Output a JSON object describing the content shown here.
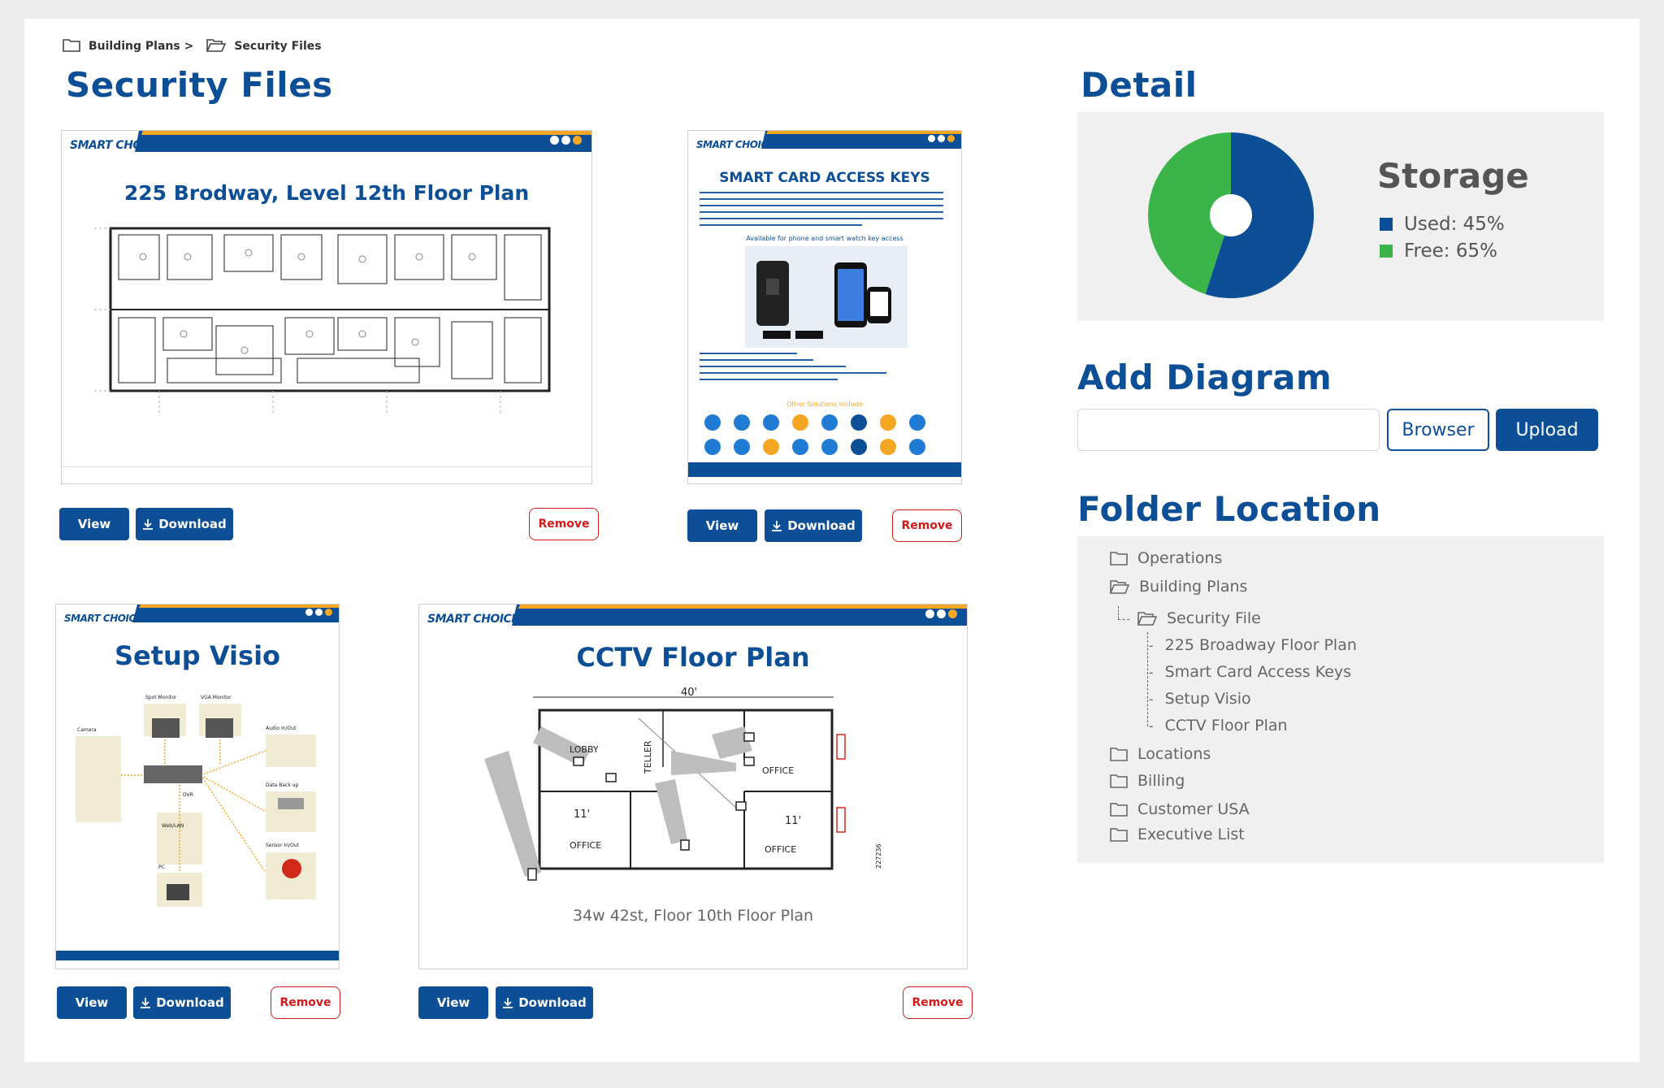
{
  "breadcrumb": {
    "parent": "Building Plans >",
    "current": "Security Files",
    "parent_icon": "folder-icon",
    "current_icon": "folder-open-icon"
  },
  "page_title": "Security Files",
  "colors": {
    "brand_blue": "#0d4f97",
    "accent_orange": "#f5a623",
    "remove_red": "#d11a1a",
    "chart_used": "#0d4f97",
    "chart_free": "#3bb54a"
  },
  "files": [
    {
      "logo": "SMART CHOICE",
      "title": "225 Brodway, Level 12th Floor Plan",
      "thumbnail": "floor-plan-drawing",
      "actions": {
        "view": "View",
        "download": "Download",
        "remove": "Remove"
      }
    },
    {
      "logo": "SMART CHOICE",
      "title": "SMART CARD ACCESS KEYS",
      "subtitle": "Available for phone and smart watch key access",
      "other": "Other Solutions Include",
      "thumbnail": "access-keys-brochure",
      "actions": {
        "view": "View",
        "download": "Download",
        "remove": "Remove"
      }
    },
    {
      "logo": "SMART CHOICE",
      "title": "Setup Visio",
      "thumbnail": "visio-diagram",
      "labels": [
        "Spot Monitor",
        "VGA Monitor",
        "Audio In/Out",
        "Camera",
        "DVR",
        "Data Back up",
        "Web/LAN",
        "Sensor In/Out",
        "PC"
      ],
      "actions": {
        "view": "View",
        "download": "Download",
        "remove": "Remove"
      }
    },
    {
      "logo": "SMART CHOICE",
      "title": "CCTV Floor Plan",
      "caption": "34w 42st, Floor 10th Floor Plan",
      "thumbnail": "cctv-plan",
      "labels": [
        "40'",
        "LOBBY",
        "TELLER",
        "OFFICE",
        "11'",
        "OFFICE",
        "11'",
        "OFFICE",
        "227236"
      ],
      "actions": {
        "view": "View",
        "download": "Download",
        "remove": "Remove"
      }
    }
  ],
  "detail": {
    "title": "Detail",
    "storage_label": "Storage",
    "used_label": "Used: 45%",
    "free_label": "Free: 65%"
  },
  "chart_data": {
    "type": "pie",
    "categories": [
      "Used",
      "Free"
    ],
    "values": [
      55,
      45
    ],
    "printed_labels": [
      "Used: 45%",
      "Free: 65%"
    ],
    "colors": [
      "#0d4f97",
      "#3bb54a"
    ],
    "donut_hole": true,
    "legend_position": "right"
  },
  "add_diagram": {
    "title": "Add Diagram",
    "input_value": "",
    "browse_label": "Browser",
    "upload_label": "Upload"
  },
  "folder_location": {
    "title": "Folder Location",
    "items": [
      {
        "label": "Operations",
        "icon": "folder-icon"
      },
      {
        "label": "Building Plans",
        "icon": "folder-open-icon"
      },
      {
        "label": "Security File",
        "icon": "folder-open-icon"
      },
      {
        "label": "225 Broadway Floor Plan"
      },
      {
        "label": "Smart Card Access Keys"
      },
      {
        "label": "Setup Visio"
      },
      {
        "label": "CCTV Floor Plan"
      },
      {
        "label": "Locations",
        "icon": "folder-icon"
      },
      {
        "label": "Billing",
        "icon": "folder-icon"
      },
      {
        "label": "Customer USA",
        "icon": "folder-icon"
      },
      {
        "label": "Executive List",
        "icon": "folder-icon"
      }
    ]
  }
}
